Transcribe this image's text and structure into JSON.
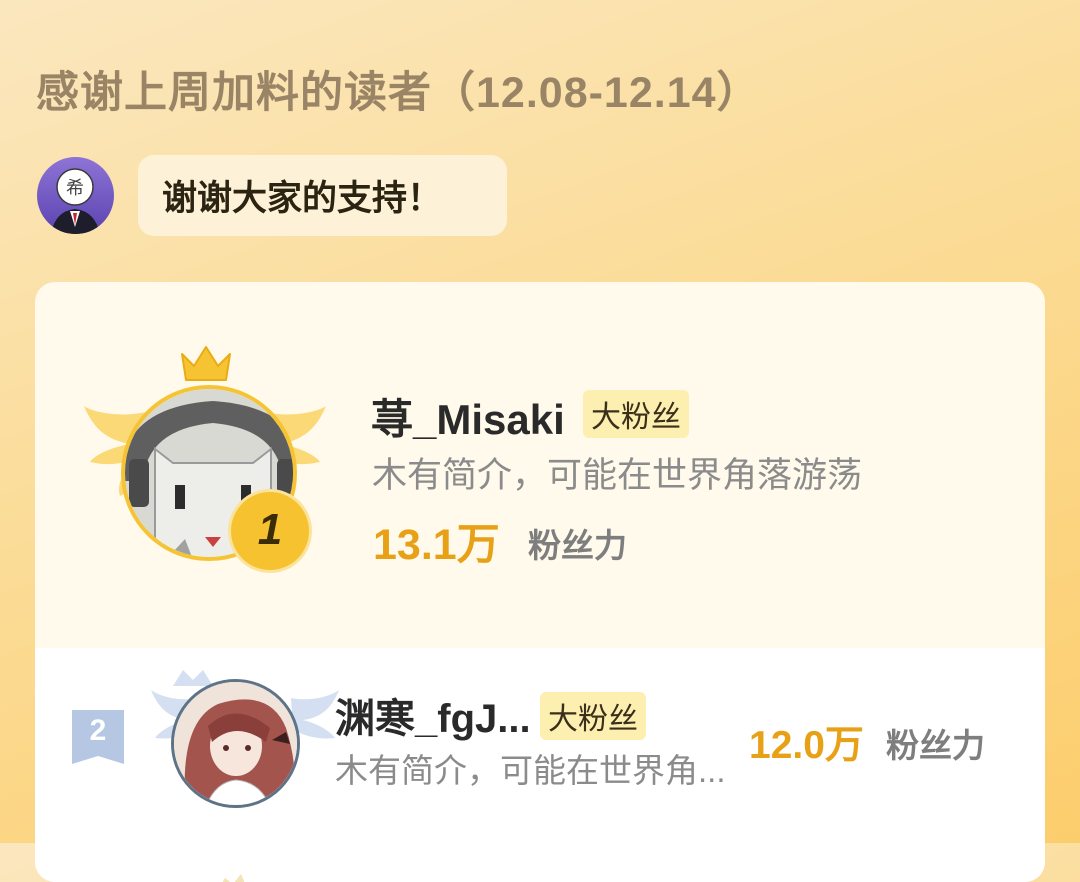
{
  "header": {
    "title": "感谢上周加料的读者（12.08-12.14）"
  },
  "greeting": {
    "message": "谢谢大家的支持！"
  },
  "ranking": [
    {
      "rank": "1",
      "name": "荨_Misaki",
      "badge": "大粉丝",
      "bio": "木有简介，可能在世界角落游荡",
      "score": "13.1万",
      "score_label": "粉丝力"
    },
    {
      "rank": "2",
      "name": "渊寒_fgJ...",
      "badge": "大粉丝",
      "bio": "木有简介，可能在世界角...",
      "score": "12.0万",
      "score_label": "粉丝力"
    }
  ],
  "colors": {
    "accent": "#e8a117",
    "badge_bg": "#fcefb0",
    "title": "#9a8466",
    "crown": "#f6c433"
  }
}
